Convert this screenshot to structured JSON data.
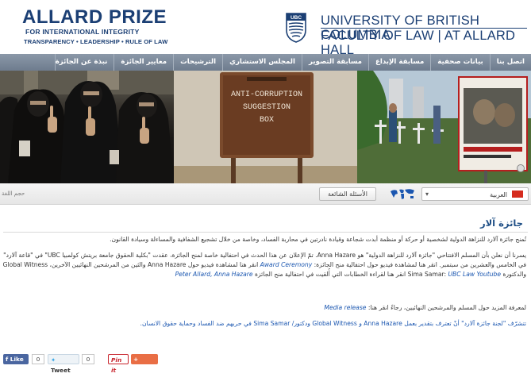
{
  "header": {
    "prize_title": "ALLARD PRIZE",
    "prize_subtitle": "FOR INTERNATIONAL INTEGRITY",
    "prize_values": "TRANSPARENCY • LEADERSHIP • RULE OF LAW",
    "ubc_logo_text": "UBC",
    "ubc_name": "UNIVERSITY OF BRITISH COLUMBIA",
    "faculty_name": "FACULTY OF LAW | AT ALLARD HALL"
  },
  "nav": {
    "items": [
      {
        "label": "اتصل بنا"
      },
      {
        "label": "بيانات صحفية"
      },
      {
        "label": "مسابقة الإبداع"
      },
      {
        "label": "مسابقة التصوير"
      },
      {
        "label": "المجلس الاستشاري"
      },
      {
        "label": "الترشيحات"
      },
      {
        "label": "معايير الجائزة"
      },
      {
        "label": "نبذة عن الجائزة"
      }
    ]
  },
  "banner": {
    "sign_line1": "ANTI-CORRUPTION",
    "sign_line2": "SUGGESTION",
    "sign_line3": "BOX"
  },
  "langbar": {
    "language": "العربية",
    "faq_label": "الأسئلة الشائعة",
    "font_size_label": "حجم اللغة"
  },
  "content": {
    "title": "جائزة آلار",
    "p1": "تُمنح جائزة آلارد للنزاهة الدولية لشخصية أو حركة أو منظمة أبدت شجاعة وقيادة نادرتين في محاربة الفساد، وخاصة من خلال تشجيع الشفافية والمساءلة وسيادة القانون.",
    "p2_a": "يسرنا أن نعلن بأن المسلم الافتتاحي \"جائزة آلارد للنزاهة الدولية\" هو ",
    "p2_name": "Anna Hazare",
    "p2_b": ". تمّ الإعلان عن هذا الحدث في احتفالية خاصة لمنح الجائزة، عقدت \"بكلية الحقوق جامعة بريتش كولمبيا UBC\" في \"قاعة آلارد\" في الخامس والعشرين من سبتمبر. انقر هنا لمشاهدة فيديو حول احتفالية منح الجائزة: ",
    "p2_link1": "Award Ceremony",
    "p2_c": " انقر هنا لمشاهدة فيديو حول Anna Hazare والثين من المرشحين النهائيين الآخرين، Global Witness والدكتورة Sima Samar: ",
    "p2_link2": "UBC Law Youtube",
    "p2_d": " انقر هنا لقراءة الخطابات التي أُلقيت في احتفالية منح الجائزة ",
    "p2_link3": "Peter Allard, Anna Hazare",
    "p3_a": "لمعرفة المزيد حول المسلم والمرشحين النهائيين، رجاءً انقر هنا: ",
    "p3_link": "Media release",
    "p4": "تتشرّف \"لجنة جائزة آلارد\" أنْ تعترف بتقدير بعمل Anna Hazare و Global Witness ودكتور/ Sima Samar في حربهم ضد الفساد وحماية حقوق الانسان."
  },
  "social": {
    "like_label": "Like",
    "like_count": "0",
    "tweet_label": "Tweet",
    "tweet_count": "0",
    "pin_label": "Pin it",
    "share_label": "Share"
  },
  "colors": {
    "brand_navy": "#1b3f74",
    "nav_bar": "#7b889a",
    "link_blue": "#1a56b0",
    "facebook": "#4a66a0",
    "share_orange": "#e96e45"
  }
}
